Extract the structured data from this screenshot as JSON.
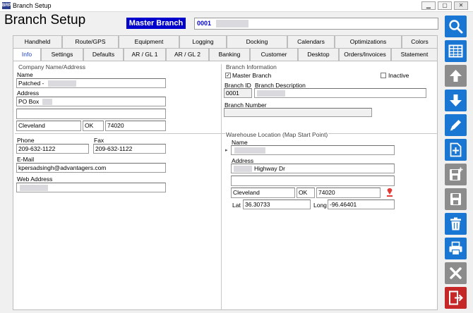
{
  "window": {
    "title": "Branch Setup",
    "app_icon_text": "BRP"
  },
  "header": {
    "title": "Branch Setup",
    "master_label": "Master Branch",
    "branch_code": "0001"
  },
  "tabs_row1": [
    "Handheld",
    "Route/GPS",
    "Equipment",
    "Logging",
    "Docking",
    "Calendars",
    "Optimizations",
    "Colors"
  ],
  "tabs_row2": [
    "Info",
    "Settings",
    "Defaults",
    "AR / GL 1",
    "AR / GL 2",
    "Banking",
    "Customer",
    "Desktop",
    "Orders/Invoices",
    "Statement"
  ],
  "company": {
    "group_title": "Company Name/Address",
    "name_label": "Name",
    "name_value": "Patched -",
    "address_label": "Address",
    "address1": "PO Box",
    "address2": "",
    "city": "Cleveland",
    "state": "OK",
    "zip": "74020",
    "phone_label": "Phone",
    "phone": "209-632-1122",
    "fax_label": "Fax",
    "fax": "209-632-1122",
    "email_label": "E-Mail",
    "email": "kpersadsingh@advantagers.com",
    "web_label": "Web Address",
    "web": ""
  },
  "branch": {
    "group_title": "Branch Information",
    "master_branch_label": "Master Branch",
    "master_branch_checked": true,
    "inactive_label": "Inactive",
    "inactive_checked": false,
    "id_label": "Branch ID",
    "id": "0001",
    "desc_label": "Branch Description",
    "desc": "",
    "number_label": "Branch Number",
    "number": ""
  },
  "warehouse": {
    "group_title": "Warehouse Location (Map Start Point)",
    "name_label": "Name",
    "name": "",
    "address_label": "Address",
    "address1": "Highway Dr",
    "address2": "",
    "city": "Cleveland",
    "state": "OK",
    "zip": "74020",
    "lat_label": "Lat",
    "lat": "36.30733",
    "long_label": "Long",
    "long": "-96.46401",
    "row_marker": "▸"
  },
  "toolbar": [
    "search-icon",
    "grid-icon",
    "arrow-up-icon",
    "arrow-down-icon",
    "edit-icon",
    "new-record-icon",
    "save-new-icon",
    "save-icon",
    "delete-icon",
    "print-icon",
    "cancel-icon",
    "exit-icon"
  ],
  "colors": {
    "accent_blue": "#1976d2",
    "grey_button": "#8c8c8c",
    "exit_red": "#c62828",
    "master_label_bg": "#0000cc"
  }
}
